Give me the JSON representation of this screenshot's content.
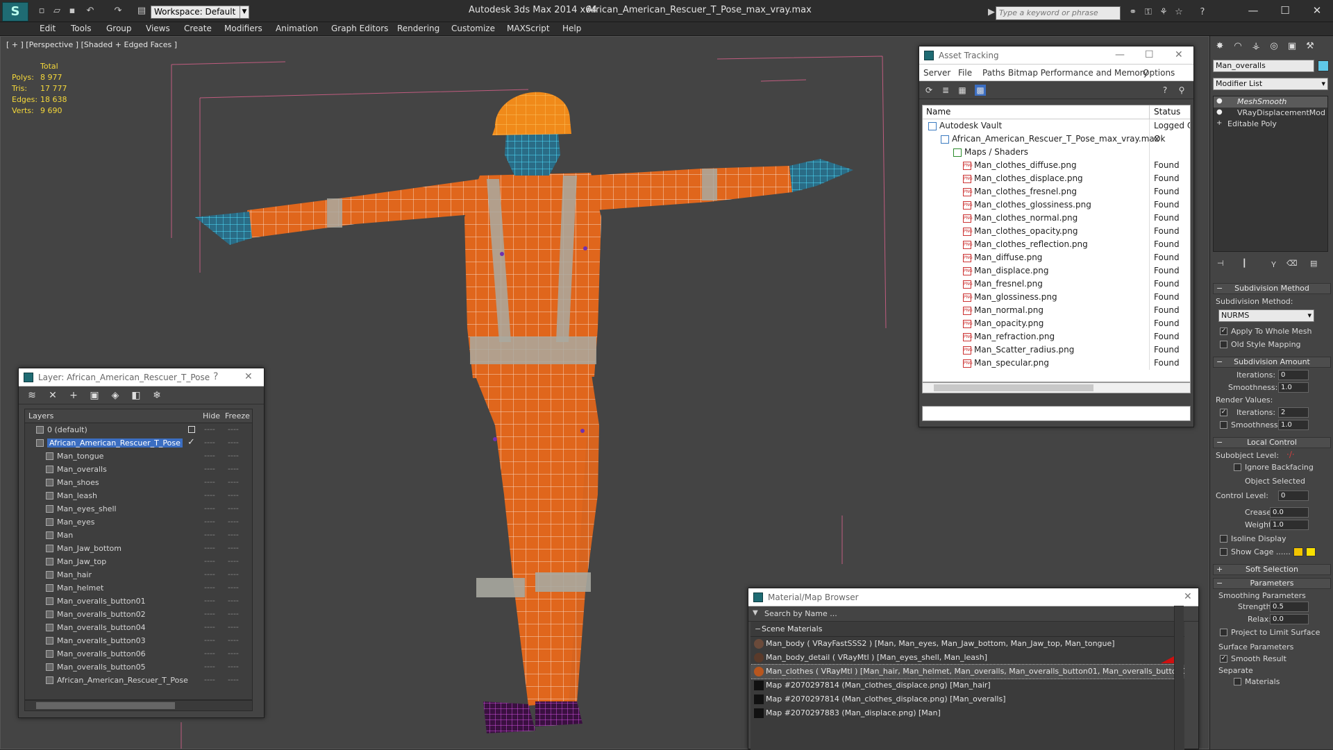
{
  "titlebar": {
    "workspace": "Workspace: Default",
    "app": "Autodesk 3ds Max  2014 x64",
    "file": "African_American_Rescuer_T_Pose_max_vray.max",
    "search_placeholder": "Type a keyword or phrase"
  },
  "menu": [
    "Edit",
    "Tools",
    "Group",
    "Views",
    "Create",
    "Modifiers",
    "Animation",
    "Graph Editors",
    "Rendering",
    "Customize",
    "MAXScript",
    "Help"
  ],
  "viewport": {
    "label": "[ + ] [Perspective ] [Shaded + Edged Faces ]",
    "stats_header": "Total",
    "stats": [
      {
        "label": "Polys:",
        "value": "8 977"
      },
      {
        "label": "Tris:",
        "value": "17 777"
      },
      {
        "label": "Edges:",
        "value": "18 638"
      },
      {
        "label": "Verts:",
        "value": "9 690"
      }
    ]
  },
  "layer_window": {
    "title": "Layer: African_American_Rescuer_T_Pose",
    "help": "?",
    "close": "✕",
    "col_layers": "Layers",
    "col_hide": "Hide",
    "col_freeze": "Freeze",
    "rows": [
      {
        "name": "0 (default)",
        "level": 1
      },
      {
        "name": "African_American_Rescuer_T_Pose",
        "level": 1,
        "selected": true
      },
      {
        "name": "Man_tongue",
        "level": 2
      },
      {
        "name": "Man_overalls",
        "level": 2
      },
      {
        "name": "Man_shoes",
        "level": 2
      },
      {
        "name": "Man_leash",
        "level": 2
      },
      {
        "name": "Man_eyes_shell",
        "level": 2
      },
      {
        "name": "Man_eyes",
        "level": 2
      },
      {
        "name": "Man",
        "level": 2
      },
      {
        "name": "Man_Jaw_bottom",
        "level": 2
      },
      {
        "name": "Man_Jaw_top",
        "level": 2
      },
      {
        "name": "Man_hair",
        "level": 2
      },
      {
        "name": "Man_helmet",
        "level": 2
      },
      {
        "name": "Man_overalls_button01",
        "level": 2
      },
      {
        "name": "Man_overalls_button02",
        "level": 2
      },
      {
        "name": "Man_overalls_button04",
        "level": 2
      },
      {
        "name": "Man_overalls_button03",
        "level": 2
      },
      {
        "name": "Man_overalls_button06",
        "level": 2
      },
      {
        "name": "Man_overalls_button05",
        "level": 2
      },
      {
        "name": "African_American_Rescuer_T_Pose",
        "level": 2
      }
    ]
  },
  "asset_window": {
    "title": "Asset Tracking",
    "menu": [
      "Server",
      "File",
      "Paths",
      "Bitmap Performance and Memory",
      "Options"
    ],
    "col_name": "Name",
    "col_status": "Status",
    "rows": [
      {
        "name": "Autodesk Vault",
        "status": "Logged O",
        "level": 0
      },
      {
        "name": "African_American_Rescuer_T_Pose_max_vray.max",
        "status": "Ok",
        "level": 1
      },
      {
        "name": "Maps / Shaders",
        "status": "",
        "level": 2
      },
      {
        "name": "Man_clothes_diffuse.png",
        "status": "Found",
        "level": 3
      },
      {
        "name": "Man_clothes_displace.png",
        "status": "Found",
        "level": 3
      },
      {
        "name": "Man_clothes_fresnel.png",
        "status": "Found",
        "level": 3
      },
      {
        "name": "Man_clothes_glossiness.png",
        "status": "Found",
        "level": 3
      },
      {
        "name": "Man_clothes_normal.png",
        "status": "Found",
        "level": 3
      },
      {
        "name": "Man_clothes_opacity.png",
        "status": "Found",
        "level": 3
      },
      {
        "name": "Man_clothes_reflection.png",
        "status": "Found",
        "level": 3
      },
      {
        "name": "Man_diffuse.png",
        "status": "Found",
        "level": 3
      },
      {
        "name": "Man_displace.png",
        "status": "Found",
        "level": 3
      },
      {
        "name": "Man_fresnel.png",
        "status": "Found",
        "level": 3
      },
      {
        "name": "Man_glossiness.png",
        "status": "Found",
        "level": 3
      },
      {
        "name": "Man_normal.png",
        "status": "Found",
        "level": 3
      },
      {
        "name": "Man_opacity.png",
        "status": "Found",
        "level": 3
      },
      {
        "name": "Man_refraction.png",
        "status": "Found",
        "level": 3
      },
      {
        "name": "Man_Scatter_radius.png",
        "status": "Found",
        "level": 3
      },
      {
        "name": "Man_specular.png",
        "status": "Found",
        "level": 3
      }
    ]
  },
  "material_browser": {
    "title": "Material/Map Browser",
    "search_placeholder": "Search by Name ...",
    "group": "Scene Materials",
    "rows": [
      {
        "text": "Man_body  ( VRayFastSSS2 )  [Man, Man_eyes, Man_Jaw_bottom, Man_Jaw_top, Man_tongue]",
        "swatch": "#6a4a3a"
      },
      {
        "text": "Man_body_detail  ( VRayMtl )  [Man_eyes_shell, Man_leash]",
        "swatch": "#5a3a2a"
      },
      {
        "text": "Man_clothes  ( VRayMtl )  [Man_hair, Man_helmet, Man_overalls, Man_overalls_button01, Man_overalls_button02,...",
        "swatch": "#b8561e",
        "selected": true
      },
      {
        "text": "Map #2070297814 (Man_clothes_displace.png)  [Man_hair]",
        "swatch": "#111111"
      },
      {
        "text": "Map #2070297814 (Man_clothes_displace.png)  [Man_overalls]",
        "swatch": "#111111"
      },
      {
        "text": "Map #2070297883 (Man_displace.png)  [Man]",
        "swatch": "#111111"
      }
    ]
  },
  "command_panel": {
    "object_name": "Man_overalls",
    "modifier_list": "Modifier List",
    "stack": [
      "MeshSmooth",
      "VRayDisplacementMod",
      "Editable Poly"
    ],
    "subdivision_method_head": "Subdivision Method",
    "subdivision_method_label": "Subdivision Method:",
    "subdivision_method_value": "NURMS",
    "apply_whole_mesh": "Apply To Whole Mesh",
    "old_style_mapping": "Old Style Mapping",
    "subdivision_amount_head": "Subdivision Amount",
    "iterations_label": "Iterations:",
    "iterations_value": "0",
    "smoothness_label": "Smoothness:",
    "smoothness_value": "1.0",
    "render_values_label": "Render Values:",
    "render_iterations_value": "2",
    "render_smoothness_value": "1.0",
    "local_control_head": "Local Control",
    "subobject_level": "Subobject Level:",
    "ignore_backfacing": "Ignore Backfacing",
    "object_selected": "Object Selected",
    "control_level_label": "Control Level:",
    "control_level_value": "0",
    "crease_label": "Crease:",
    "crease_value": "0.0",
    "weight_label": "Weight:",
    "weight_value": "1.0",
    "isoline_display": "Isoline Display",
    "show_cage": "Show Cage ......",
    "soft_selection_head": "Soft Selection",
    "parameters_head": "Parameters",
    "smoothing_params": "Smoothing Parameters",
    "strength_label": "Strength:",
    "strength_value": "0.5",
    "relax_label": "Relax:",
    "relax_value": "0.0",
    "project_limit": "Project to Limit Surface",
    "surface_params": "Surface Parameters",
    "smooth_result": "Smooth Result",
    "separate_label": "Separate",
    "materials_label": "Materials"
  },
  "colors": {
    "overalls": "#e0661c",
    "reflective": "#a9a9a0",
    "skin_wire": "#3fd3f0",
    "helmet": "#f08a1a",
    "shoes": "#c040d0",
    "selection": "#3b6ec2",
    "stats": "#f5d83a"
  }
}
